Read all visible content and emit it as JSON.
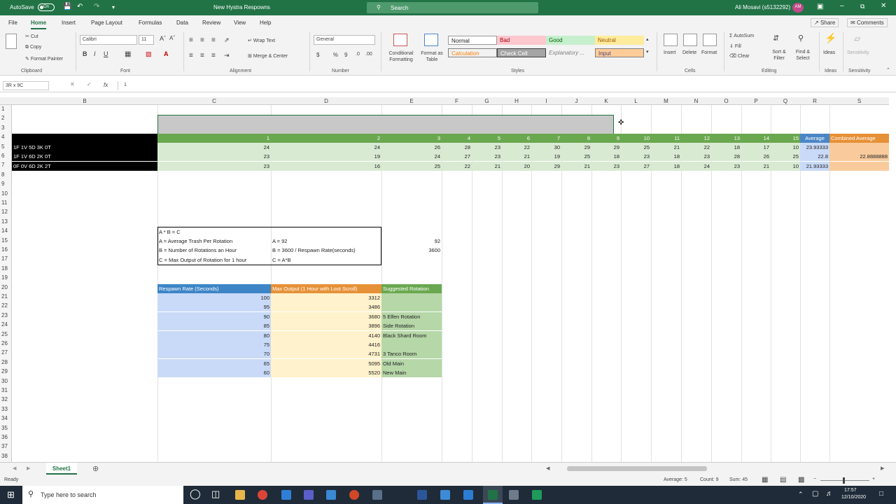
{
  "titlebar": {
    "autosave": "AutoSave",
    "autosave_state": "On",
    "doc_title": "New Hystra Respowns",
    "search_placeholder": "Search",
    "user": "Ali Mosavi (s5132292)",
    "user_initials": "AM"
  },
  "tabs": [
    "File",
    "Home",
    "Insert",
    "Page Layout",
    "Formulas",
    "Data",
    "Review",
    "View",
    "Help"
  ],
  "share": "Share",
  "comments": "Comments",
  "ribbon": {
    "clipboard": {
      "cut": "Cut",
      "copy": "Copy",
      "format_painter": "Format Painter",
      "label": "Clipboard"
    },
    "font": {
      "name": "Calibri",
      "size": "11",
      "label": "Font"
    },
    "alignment": {
      "wrap": "Wrap Text",
      "merge": "Merge & Center",
      "label": "Alignment"
    },
    "number": {
      "format": "General",
      "label": "Number"
    },
    "styles": {
      "conditional": "Conditional Formatting",
      "format_as_table": "Format as Table",
      "normal": "Normal",
      "bad": "Bad",
      "good": "Good",
      "neutral": "Neutral",
      "calculation": "Calculation",
      "check_cell": "Check Cell",
      "explanatory": "Explanatory ...",
      "input": "Input",
      "label": "Styles"
    },
    "cells": {
      "insert": "Insert",
      "delete": "Delete",
      "format": "Format",
      "label": "Cells"
    },
    "editing": {
      "autosum": "AutoSum",
      "fill": "Fill",
      "clear": "Clear",
      "sort_filter": "Sort & Filter",
      "find_select": "Find & Select",
      "label": "Editing"
    },
    "ideas": {
      "button": "Ideas",
      "label": "Ideas"
    },
    "sensitivity": {
      "button": "Sensitivity",
      "label": "Sensitivity"
    }
  },
  "formula": {
    "namebox": "3R x 9C",
    "fx": "fx",
    "value": "1"
  },
  "columns": [
    "B",
    "C",
    "D",
    "E",
    "F",
    "G",
    "H",
    "I",
    "J",
    "K",
    "L",
    "M",
    "N",
    "O",
    "P",
    "Q",
    "R",
    "S"
  ],
  "rows": [
    "1",
    "2",
    "3",
    "4",
    "5",
    "6",
    "7",
    "8",
    "9",
    "10",
    "11",
    "12",
    "13",
    "14",
    "15",
    "16",
    "17",
    "18",
    "19",
    "20",
    "21",
    "22",
    "23",
    "24",
    "25",
    "26",
    "27",
    "28",
    "29",
    "30",
    "31",
    "32",
    "33",
    "34",
    "35",
    "36",
    "37",
    "38"
  ],
  "header_row": {
    "numbers": [
      "1",
      "2",
      "3",
      "4",
      "5",
      "6",
      "7",
      "8",
      "9",
      "10",
      "11",
      "12",
      "13",
      "14",
      "15"
    ],
    "average": "Average",
    "combined": "Combined Average"
  },
  "data_rows": [
    {
      "label": "1F 1V 5D 3K 0T",
      "values": [
        "24",
        "24",
        "26",
        "28",
        "23",
        "22",
        "30",
        "29",
        "29",
        "25",
        "21",
        "22",
        "18",
        "17",
        "10"
      ],
      "average": "23.93333",
      "combined": ""
    },
    {
      "label": "1F 1V 6D 2K 0T",
      "values": [
        "23",
        "19",
        "24",
        "27",
        "23",
        "21",
        "19",
        "25",
        "18",
        "23",
        "18",
        "23",
        "28",
        "26",
        "25"
      ],
      "average": "22.8",
      "combined": "22.8888888"
    },
    {
      "label": "0F 0V 6D 2K 2T",
      "values": [
        "23",
        "16",
        "25",
        "22",
        "21",
        "20",
        "29",
        "21",
        "23",
        "27",
        "18",
        "24",
        "23",
        "21",
        "10"
      ],
      "average": "21.93333",
      "combined": ""
    }
  ],
  "formula_box": {
    "r14": "A * B = C",
    "r15a": "A = Average Trash Per Rotation",
    "r15b": "A = 92",
    "r15c": "92",
    "r16a": "B = Number of Rotations an Hour",
    "r16b": "B = 3600 / Respawn Rate(seconds)",
    "r16c": "3600",
    "r17a": "C = Max Output of Rotation for 1 hour",
    "r17b": "C = A*B"
  },
  "table": {
    "headers": [
      "Respawn Rate (Seconds)",
      "Max Output (1 Hour with Loot Scroll)",
      "Suggested Rotation"
    ],
    "rows": [
      [
        "100",
        "3312",
        ""
      ],
      [
        "95",
        "3486",
        ""
      ],
      [
        "90",
        "3680",
        "5 Elfen Rotation"
      ],
      [
        "85",
        "3896",
        "Side Rotation"
      ],
      [
        "80",
        "4140",
        "Black Shard Room"
      ],
      [
        "75",
        "4416",
        ""
      ],
      [
        "70",
        "4731",
        "3 Tanco Room"
      ],
      [
        "65",
        "5095",
        "Old Main"
      ],
      [
        "60",
        "5520",
        "New Main"
      ]
    ]
  },
  "sheet": {
    "tab": "Sheet1"
  },
  "status": {
    "ready": "Ready",
    "average": "Average: 5",
    "count": "Count: 9",
    "sum": "Sum: 45"
  },
  "taskbar": {
    "search": "Type here to search",
    "time": "17:57",
    "date": "12/10/2020"
  },
  "colors": {
    "excel_green": "#217346",
    "header_green": "#6aa84f",
    "light_green": "#d9ead3",
    "light_blue": "#c9daf8",
    "light_yellow": "#fff2cc",
    "orange": "#f6b26b"
  }
}
